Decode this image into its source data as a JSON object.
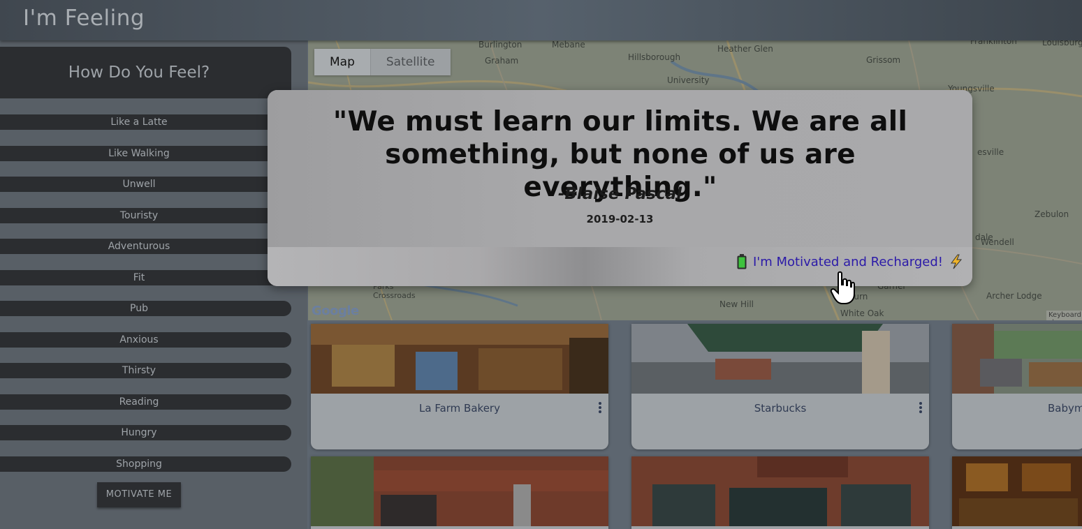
{
  "header": {
    "title": "I'm Feeling"
  },
  "sidebar": {
    "title": "How Do You Feel?",
    "moods": [
      "Like a Latte",
      "Like Walking",
      "Unwell",
      "Touristy",
      "Adventurous",
      "Fit",
      "Pub",
      "Anxious",
      "Thirsty",
      "Reading",
      "Hungry",
      "Shopping"
    ],
    "motivate_label": "MOTIVATE ME"
  },
  "map": {
    "tabs": {
      "map": "Map",
      "satellite": "Satellite"
    },
    "labels": [
      "Burlington",
      "Mebane",
      "Hillsborough",
      "Heather Glen",
      "Franklinton",
      "Louisburg",
      "Graham",
      "University",
      "Grissom",
      "Youngsville",
      "esville",
      "Zebulon",
      "dale",
      "Wendell",
      "Archer Lodge",
      "Parks Crossroads",
      "New Hill",
      "Auburn",
      "White Oak",
      "Garner",
      "Keyboard sh"
    ],
    "google": "Google"
  },
  "places": [
    {
      "name": "La Farm Bakery"
    },
    {
      "name": "Starbucks"
    },
    {
      "name": "Babym"
    }
  ],
  "modal": {
    "quote": "\"We must learn our limits. We are all something, but none of us are everything.\"",
    "author": "-Blaise Pascal",
    "date": "2019-02-13",
    "action_label": "I'm Motivated and Recharged!"
  },
  "icons": {
    "battery": "battery-full-icon",
    "bolt": "lightning-icon",
    "cursor": "hand-pointer-icon"
  }
}
